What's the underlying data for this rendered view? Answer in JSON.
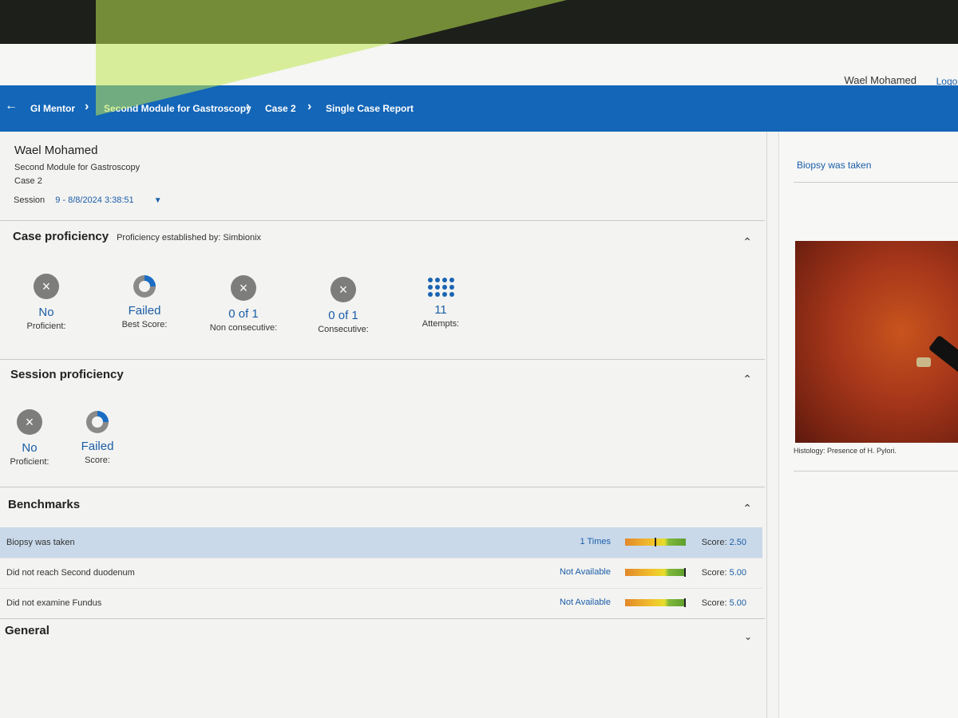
{
  "header": {
    "user_name": "Wael Mohamed",
    "logout": "Logou"
  },
  "breadcrumb": {
    "back_icon": "arrow-left-icon",
    "items": [
      "GI Mentor",
      "Second Module for Gastroscopy",
      "Case 2",
      "Single Case Report"
    ]
  },
  "report": {
    "name": "Wael Mohamed",
    "module": "Second Module for Gastroscopy",
    "case": "Case 2",
    "session_label": "Session",
    "session_value": "9 - 8/8/2024 3:38:51"
  },
  "case_proficiency": {
    "title": "Case proficiency",
    "subtitle": "Proficiency established by: Simbionix",
    "stats": [
      {
        "icon": "x-circle-icon",
        "value": "No",
        "label": "Proficient:"
      },
      {
        "icon": "donut-icon",
        "value": "Failed",
        "label": "Best Score:"
      },
      {
        "icon": "x-circle-icon",
        "value": "0 of 1",
        "label": "Non consecutive:"
      },
      {
        "icon": "x-circle-icon",
        "value": "0 of 1",
        "label": "Consecutive:"
      },
      {
        "icon": "dots-grid-icon",
        "value": "11",
        "label": "Attempts:"
      }
    ]
  },
  "session_proficiency": {
    "title": "Session proficiency",
    "stats": [
      {
        "icon": "x-circle-icon",
        "value": "No",
        "label": "Proficient:"
      },
      {
        "icon": "donut-icon",
        "value": "Failed",
        "label": "Score:"
      }
    ]
  },
  "benchmarks": {
    "title": "Benchmarks",
    "rows": [
      {
        "name": "Biopsy was taken",
        "times": "1 Times",
        "score_label": "Score:",
        "score": "2.50",
        "marker": 0.5
      },
      {
        "name": "Did not reach Second duodenum",
        "times": "Not Available",
        "score_label": "Score:",
        "score": "5.00",
        "marker": 1.0
      },
      {
        "name": "Did not examine Fundus",
        "times": "Not Available",
        "score_label": "Score:",
        "score": "5.00",
        "marker": 1.0
      }
    ]
  },
  "general": {
    "title": "General"
  },
  "right_panel": {
    "title": "Biopsy was taken",
    "caption": "Histology: Presence of H. Pylori."
  },
  "colors": {
    "nav": "#1366b8",
    "accent": "#1b5ea8",
    "selected_row": "#c9d9ea"
  }
}
